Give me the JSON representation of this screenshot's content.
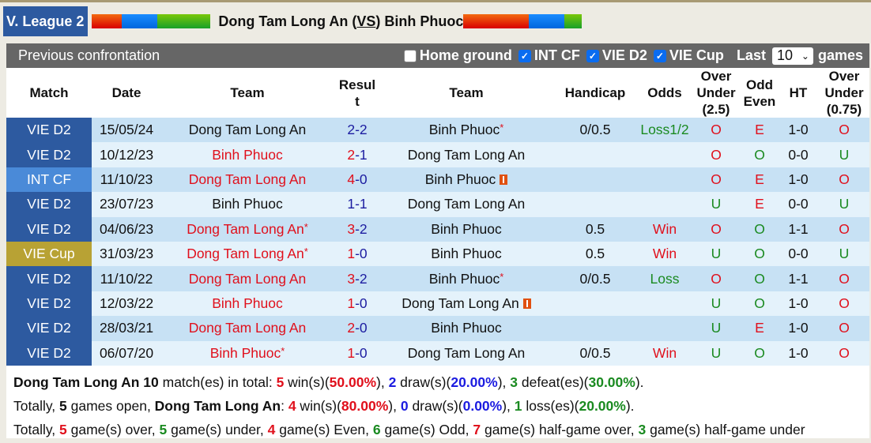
{
  "header": {
    "league": "V. League 2",
    "home_team": "Dong Tam Long An",
    "vs_open": " (",
    "vs": "VS",
    "vs_close": ") ",
    "away_team": "Binh Phuoc",
    "colors": {
      "red": "#d80000",
      "blue": "#0066dd",
      "green": "#18a028",
      "league_bg": "#2d5aa0"
    }
  },
  "panel": {
    "title": "Previous confrontation",
    "filters": [
      {
        "label": "Home ground",
        "checked": false
      },
      {
        "label": "INT CF",
        "checked": true
      },
      {
        "label": "VIE D2",
        "checked": true
      },
      {
        "label": "VIE Cup",
        "checked": true
      }
    ],
    "last_label": "Last",
    "last_value": "10",
    "games_label": "games"
  },
  "table": {
    "columns": [
      "Match",
      "Date",
      "Team",
      "Result",
      "Team",
      "Handicap",
      "Odds",
      "Over Under (2.5)",
      "Odd Even",
      "HT",
      "Over Under (0.75)"
    ],
    "column_lines": {
      "result": [
        "Resul",
        "t"
      ],
      "ou25": [
        "Over",
        "Under",
        "(2.5)"
      ],
      "oddeven": [
        "Odd",
        "Even"
      ],
      "ou075": [
        "Over",
        "Under",
        "(0.75)"
      ]
    },
    "rows": [
      {
        "league": "VIE D2",
        "league_color": "#2d5aa0",
        "date": "15/05/24",
        "home": "Dong Tam Long An",
        "home_color": "black",
        "home_star": false,
        "home_card": false,
        "score_h": "2",
        "score_a": "2",
        "score_h_color": "blue",
        "score_a_color": "blue",
        "away": "Binh Phuoc",
        "away_color": "black",
        "away_star": true,
        "away_card": false,
        "handicap": "0/0.5",
        "odds": "Loss1/2",
        "odds_color": "green",
        "ou25": "O",
        "ou25_color": "red",
        "oe": "E",
        "oe_color": "red",
        "ht": "1-0",
        "ou075": "O",
        "ou075_color": "red"
      },
      {
        "league": "VIE D2",
        "league_color": "#2d5aa0",
        "date": "10/12/23",
        "home": "Binh Phuoc",
        "home_color": "red",
        "home_star": false,
        "home_card": false,
        "score_h": "2",
        "score_a": "1",
        "score_h_color": "red",
        "score_a_color": "blue",
        "away": "Dong Tam Long An",
        "away_color": "black",
        "away_star": false,
        "away_card": false,
        "handicap": "",
        "odds": "",
        "odds_color": "",
        "ou25": "O",
        "ou25_color": "red",
        "oe": "O",
        "oe_color": "green",
        "ht": "0-0",
        "ou075": "U",
        "ou075_color": "green"
      },
      {
        "league": "INT CF",
        "league_color": "#4a8ad8",
        "date": "11/10/23",
        "home": "Dong Tam Long An",
        "home_color": "red",
        "home_star": false,
        "home_card": false,
        "score_h": "4",
        "score_a": "0",
        "score_h_color": "red",
        "score_a_color": "blue",
        "away": "Binh Phuoc",
        "away_color": "black",
        "away_star": false,
        "away_card": true,
        "handicap": "",
        "odds": "",
        "odds_color": "",
        "ou25": "O",
        "ou25_color": "red",
        "oe": "E",
        "oe_color": "red",
        "ht": "1-0",
        "ou075": "O",
        "ou075_color": "red"
      },
      {
        "league": "VIE D2",
        "league_color": "#2d5aa0",
        "date": "23/07/23",
        "home": "Binh Phuoc",
        "home_color": "black",
        "home_star": false,
        "home_card": false,
        "score_h": "1",
        "score_a": "1",
        "score_h_color": "blue",
        "score_a_color": "blue",
        "away": "Dong Tam Long An",
        "away_color": "black",
        "away_star": false,
        "away_card": false,
        "handicap": "",
        "odds": "",
        "odds_color": "",
        "ou25": "U",
        "ou25_color": "green",
        "oe": "E",
        "oe_color": "red",
        "ht": "0-0",
        "ou075": "U",
        "ou075_color": "green"
      },
      {
        "league": "VIE D2",
        "league_color": "#2d5aa0",
        "date": "04/06/23",
        "home": "Dong Tam Long An",
        "home_color": "red",
        "home_star": true,
        "home_card": false,
        "score_h": "3",
        "score_a": "2",
        "score_h_color": "red",
        "score_a_color": "blue",
        "away": "Binh Phuoc",
        "away_color": "black",
        "away_star": false,
        "away_card": false,
        "handicap": "0.5",
        "odds": "Win",
        "odds_color": "red",
        "ou25": "O",
        "ou25_color": "red",
        "oe": "O",
        "oe_color": "green",
        "ht": "1-1",
        "ou075": "O",
        "ou075_color": "red"
      },
      {
        "league": "VIE Cup",
        "league_color": "#b8a234",
        "date": "31/03/23",
        "home": "Dong Tam Long An",
        "home_color": "red",
        "home_star": true,
        "home_card": false,
        "score_h": "1",
        "score_a": "0",
        "score_h_color": "red",
        "score_a_color": "blue",
        "away": "Binh Phuoc",
        "away_color": "black",
        "away_star": false,
        "away_card": false,
        "handicap": "0.5",
        "odds": "Win",
        "odds_color": "red",
        "ou25": "U",
        "ou25_color": "green",
        "oe": "O",
        "oe_color": "green",
        "ht": "0-0",
        "ou075": "U",
        "ou075_color": "green"
      },
      {
        "league": "VIE D2",
        "league_color": "#2d5aa0",
        "date": "11/10/22",
        "home": "Dong Tam Long An",
        "home_color": "red",
        "home_star": false,
        "home_card": false,
        "score_h": "3",
        "score_a": "2",
        "score_h_color": "red",
        "score_a_color": "blue",
        "away": "Binh Phuoc",
        "away_color": "black",
        "away_star": true,
        "away_card": false,
        "handicap": "0/0.5",
        "odds": "Loss",
        "odds_color": "green",
        "ou25": "O",
        "ou25_color": "red",
        "oe": "O",
        "oe_color": "green",
        "ht": "1-1",
        "ou075": "O",
        "ou075_color": "red"
      },
      {
        "league": "VIE D2",
        "league_color": "#2d5aa0",
        "date": "12/03/22",
        "home": "Binh Phuoc",
        "home_color": "red",
        "home_star": false,
        "home_card": false,
        "score_h": "1",
        "score_a": "0",
        "score_h_color": "red",
        "score_a_color": "blue",
        "away": "Dong Tam Long An",
        "away_color": "black",
        "away_star": false,
        "away_card": true,
        "handicap": "",
        "odds": "",
        "odds_color": "",
        "ou25": "U",
        "ou25_color": "green",
        "oe": "O",
        "oe_color": "green",
        "ht": "1-0",
        "ou075": "O",
        "ou075_color": "red"
      },
      {
        "league": "VIE D2",
        "league_color": "#2d5aa0",
        "date": "28/03/21",
        "home": "Dong Tam Long An",
        "home_color": "red",
        "home_star": false,
        "home_card": false,
        "score_h": "2",
        "score_a": "0",
        "score_h_color": "red",
        "score_a_color": "blue",
        "away": "Binh Phuoc",
        "away_color": "black",
        "away_star": false,
        "away_card": false,
        "handicap": "",
        "odds": "",
        "odds_color": "",
        "ou25": "U",
        "ou25_color": "green",
        "oe": "E",
        "oe_color": "red",
        "ht": "1-0",
        "ou075": "O",
        "ou075_color": "red"
      },
      {
        "league": "VIE D2",
        "league_color": "#2d5aa0",
        "date": "06/07/20",
        "home": "Binh Phuoc",
        "home_color": "red",
        "home_star": true,
        "home_card": false,
        "score_h": "1",
        "score_a": "0",
        "score_h_color": "red",
        "score_a_color": "blue",
        "away": "Dong Tam Long An",
        "away_color": "black",
        "away_star": false,
        "away_card": false,
        "handicap": "0/0.5",
        "odds": "Win",
        "odds_color": "red",
        "ou25": "U",
        "ou25_color": "green",
        "oe": "O",
        "oe_color": "green",
        "ht": "1-0",
        "ou075": "O",
        "ou075_color": "red"
      }
    ]
  },
  "summary": {
    "line1": [
      {
        "t": "Dong Tam Long An 10",
        "s": "b"
      },
      {
        "t": " match(es) in total: ",
        "s": ""
      },
      {
        "t": "5",
        "s": "sr"
      },
      {
        "t": " win(s)(",
        "s": ""
      },
      {
        "t": "50.00%",
        "s": "sr"
      },
      {
        "t": "), ",
        "s": ""
      },
      {
        "t": "2",
        "s": "sb"
      },
      {
        "t": " draw(s)(",
        "s": ""
      },
      {
        "t": "20.00%",
        "s": "sb"
      },
      {
        "t": "), ",
        "s": ""
      },
      {
        "t": "3",
        "s": "sg"
      },
      {
        "t": " defeat(es)(",
        "s": ""
      },
      {
        "t": "30.00%",
        "s": "sg"
      },
      {
        "t": ").",
        "s": ""
      }
    ],
    "line2": [
      {
        "t": "Totally, ",
        "s": ""
      },
      {
        "t": "5",
        "s": "b"
      },
      {
        "t": " games open, ",
        "s": ""
      },
      {
        "t": "Dong Tam Long An",
        "s": "b"
      },
      {
        "t": ": ",
        "s": ""
      },
      {
        "t": "4",
        "s": "sr"
      },
      {
        "t": " win(s)(",
        "s": ""
      },
      {
        "t": "80.00%",
        "s": "sr"
      },
      {
        "t": "), ",
        "s": ""
      },
      {
        "t": "0",
        "s": "sb"
      },
      {
        "t": " draw(s)(",
        "s": ""
      },
      {
        "t": "0.00%",
        "s": "sb"
      },
      {
        "t": "), ",
        "s": ""
      },
      {
        "t": "1",
        "s": "sg"
      },
      {
        "t": " loss(es)(",
        "s": ""
      },
      {
        "t": "20.00%",
        "s": "sg"
      },
      {
        "t": ").",
        "s": ""
      }
    ],
    "line3": [
      {
        "t": "Totally, ",
        "s": ""
      },
      {
        "t": "5",
        "s": "sr"
      },
      {
        "t": " game(s) over, ",
        "s": ""
      },
      {
        "t": "5",
        "s": "sg"
      },
      {
        "t": " game(s) under, ",
        "s": ""
      },
      {
        "t": "4",
        "s": "sr"
      },
      {
        "t": " game(s) Even, ",
        "s": ""
      },
      {
        "t": "6",
        "s": "sg"
      },
      {
        "t": " game(s) Odd, ",
        "s": ""
      },
      {
        "t": "7",
        "s": "sr"
      },
      {
        "t": " game(s) half-game over, ",
        "s": ""
      },
      {
        "t": "3",
        "s": "sg"
      },
      {
        "t": " game(s) half-game under",
        "s": ""
      }
    ]
  }
}
